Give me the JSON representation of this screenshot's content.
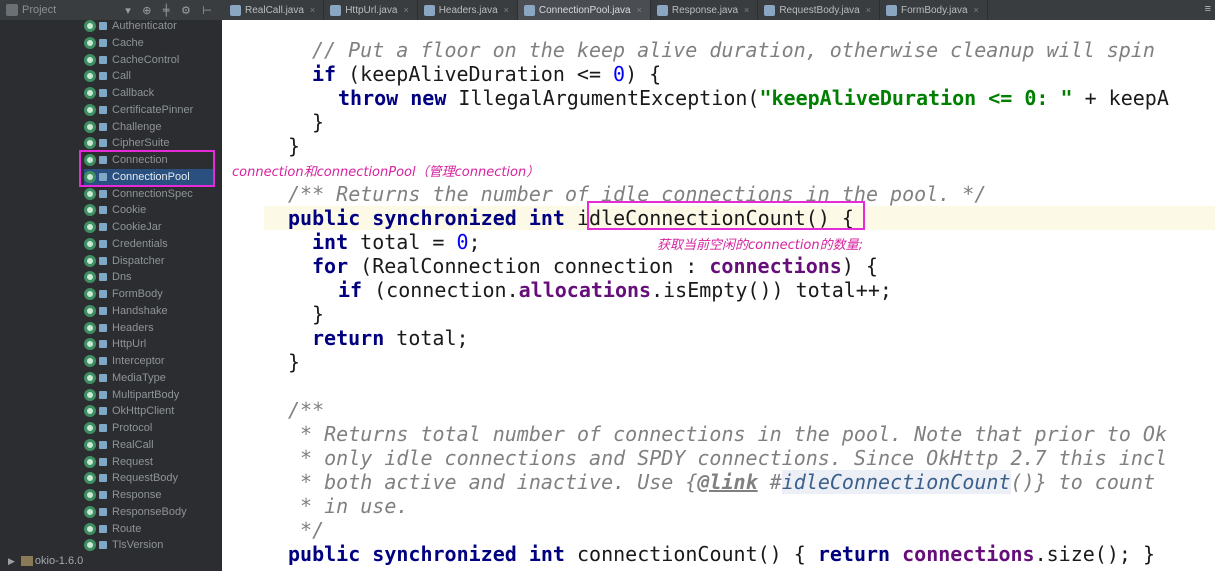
{
  "toolbar": {
    "project_label": "Project",
    "tools": "▾ ⊕ ╪ ⚙ ⊢",
    "menu": "≡"
  },
  "tabs": [
    {
      "label": "RealCall.java",
      "active": false
    },
    {
      "label": "HttpUrl.java",
      "active": false
    },
    {
      "label": "Headers.java",
      "active": false
    },
    {
      "label": "ConnectionPool.java",
      "active": true
    },
    {
      "label": "Response.java",
      "active": false
    },
    {
      "label": "RequestBody.java",
      "active": false
    },
    {
      "label": "FormBody.java",
      "active": false
    }
  ],
  "tab_close": "×",
  "sidebar": {
    "items": [
      "Authenticator",
      "Cache",
      "CacheControl",
      "Call",
      "Callback",
      "CertificatePinner",
      "Challenge",
      "CipherSuite",
      "Connection",
      "ConnectionPool",
      "ConnectionSpec",
      "Cookie",
      "CookieJar",
      "Credentials",
      "Dispatcher",
      "Dns",
      "FormBody",
      "Handshake",
      "Headers",
      "HttpUrl",
      "Interceptor",
      "MediaType",
      "MultipartBody",
      "OkHttpClient",
      "Protocol",
      "RealCall",
      "Request",
      "RequestBody",
      "Response",
      "ResponseBody",
      "Route",
      "TlsVersion"
    ],
    "selected_index": 9,
    "bottom": {
      "arrow": "▶",
      "label": "okio-1.6.0"
    }
  },
  "annotations": {
    "connection_note": "connection和connectionPool（管理connection）",
    "idle_note": "获取当前空闲的connection的数量;"
  },
  "code": {
    "l1_comment": "// Put a floor on the keep alive duration, otherwise cleanup will spin",
    "l2_if": "if",
    "l2_a": " (keepAliveDuration <= ",
    "l2_num": "0",
    "l2_b": ") {",
    "l3_throw": "throw",
    "l3_new": "new",
    "l3_a": " IllegalArgumentException(",
    "l3_str": "\"keepAliveDuration <= 0: \"",
    "l3_b": " + keepA",
    "l4": "}",
    "l5": "}",
    "l6_comment": "/** Returns the number of idle connections in the pool. */",
    "l7_public": "public",
    "l7_sync": "synchronized",
    "l7_int": "int",
    "l7_method": "idleConnectionCount()",
    "l7_b": " {",
    "l8_int": "int",
    "l8_a": " total = ",
    "l8_num": "0",
    "l8_b": ";",
    "l9_for": "for",
    "l9_a": " (RealConnection connection : ",
    "l9_fld": "connections",
    "l9_b": ") {",
    "l10_if": "if",
    "l10_a": " (connection.",
    "l10_fld": "allocations",
    "l10_b": ".isEmpty()) total++;",
    "l11": "}",
    "l12_return": "return",
    "l12_a": " total;",
    "l13": "}",
    "l14": "/**",
    "l15": " * Returns total number of connections in the pool. Note that prior to Ok",
    "l16": " * only idle connections and SPDY connections. Since OkHttp 2.7 this incl",
    "l17_a": " * both active and inactive. Use {",
    "l17_tag": "@link",
    "l17_b": " #",
    "l17_ref": "idleConnectionCount",
    "l17_c": "()} to count",
    "l18": " * in use.",
    "l19": " */",
    "l20_public": "public",
    "l20_sync": "synchronized",
    "l20_int": "int",
    "l20_a": " connectionCount() { ",
    "l20_return": "return",
    "l20_fld": "connections",
    "l20_b": ".size(); }"
  }
}
